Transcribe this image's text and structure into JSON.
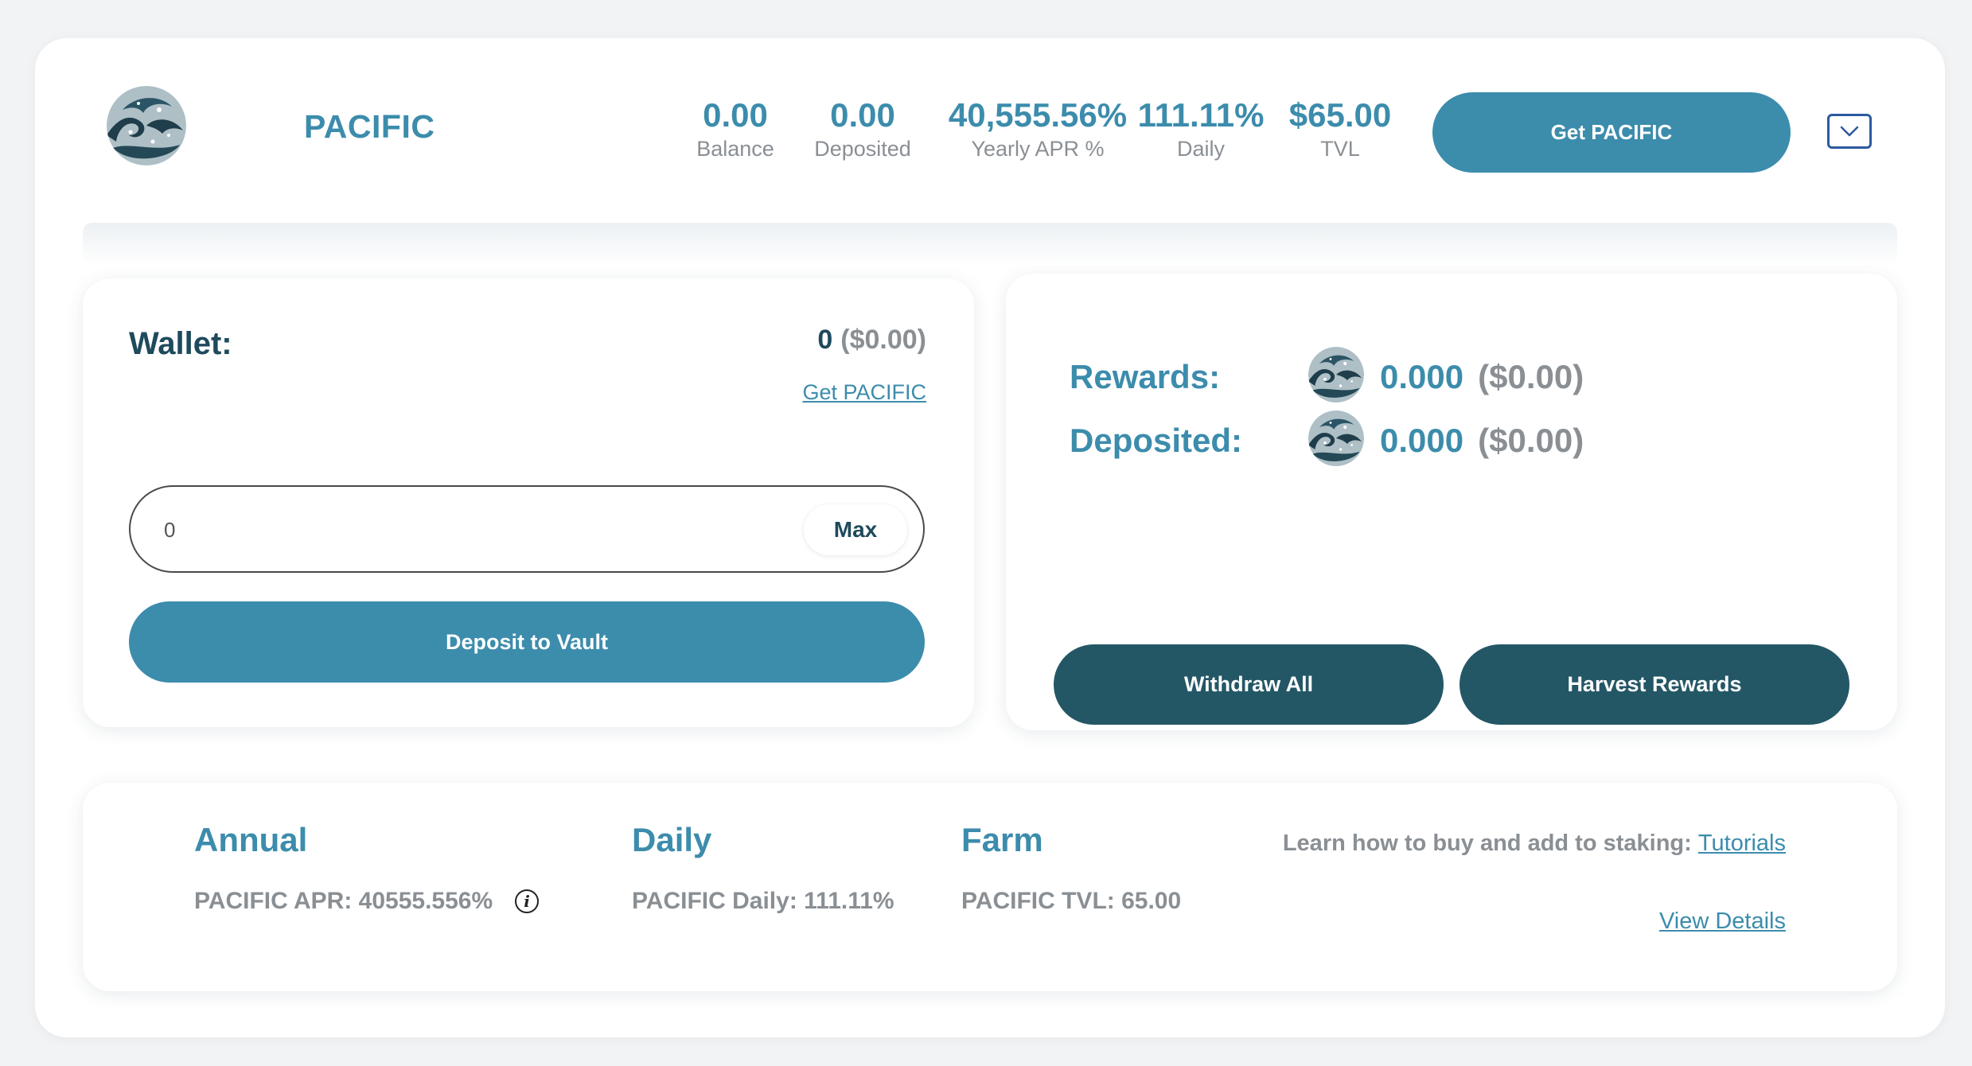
{
  "token": {
    "name": "PACIFIC",
    "logo_icon": "wave-logo-icon"
  },
  "header": {
    "stats": [
      {
        "value": "0.00",
        "label": "Balance"
      },
      {
        "value": "0.00",
        "label": "Deposited"
      },
      {
        "value": "40,555.56%",
        "label": "Yearly APR %"
      },
      {
        "value": "111.11%",
        "label": "Daily"
      },
      {
        "value": "$65.00",
        "label": "TVL"
      }
    ],
    "get_button": "Get PACIFIC",
    "expand_icon": "chevron-down-icon"
  },
  "wallet": {
    "title": "Wallet:",
    "amount": "0",
    "amount_usd": "($0.00)",
    "get_link": "Get PACIFIC",
    "input_value": "0",
    "max_label": "Max",
    "deposit_label": "Deposit to Vault"
  },
  "rewards": {
    "rewards_label": "Rewards:",
    "rewards_value": "0.000",
    "rewards_usd": "($0.00)",
    "deposited_label": "Deposited:",
    "deposited_value": "0.000",
    "deposited_usd": "($0.00)",
    "withdraw_label": "Withdraw All",
    "harvest_label": "Harvest Rewards"
  },
  "info": {
    "annual_title": "Annual",
    "annual_text": "PACIFIC APR: 40555.556%",
    "daily_title": "Daily",
    "daily_text": "PACIFIC Daily: 111.11%",
    "farm_title": "Farm",
    "farm_text": "PACIFIC TVL: 65.00",
    "learn_text": "Learn how to buy and add to staking:",
    "tutorials_link": "Tutorials",
    "view_details_link": "View Details"
  },
  "colors": {
    "accent": "#3c8cac",
    "dark_button": "#245766",
    "muted_text": "#8a8f94",
    "heading_dark": "#1e4a5c"
  }
}
